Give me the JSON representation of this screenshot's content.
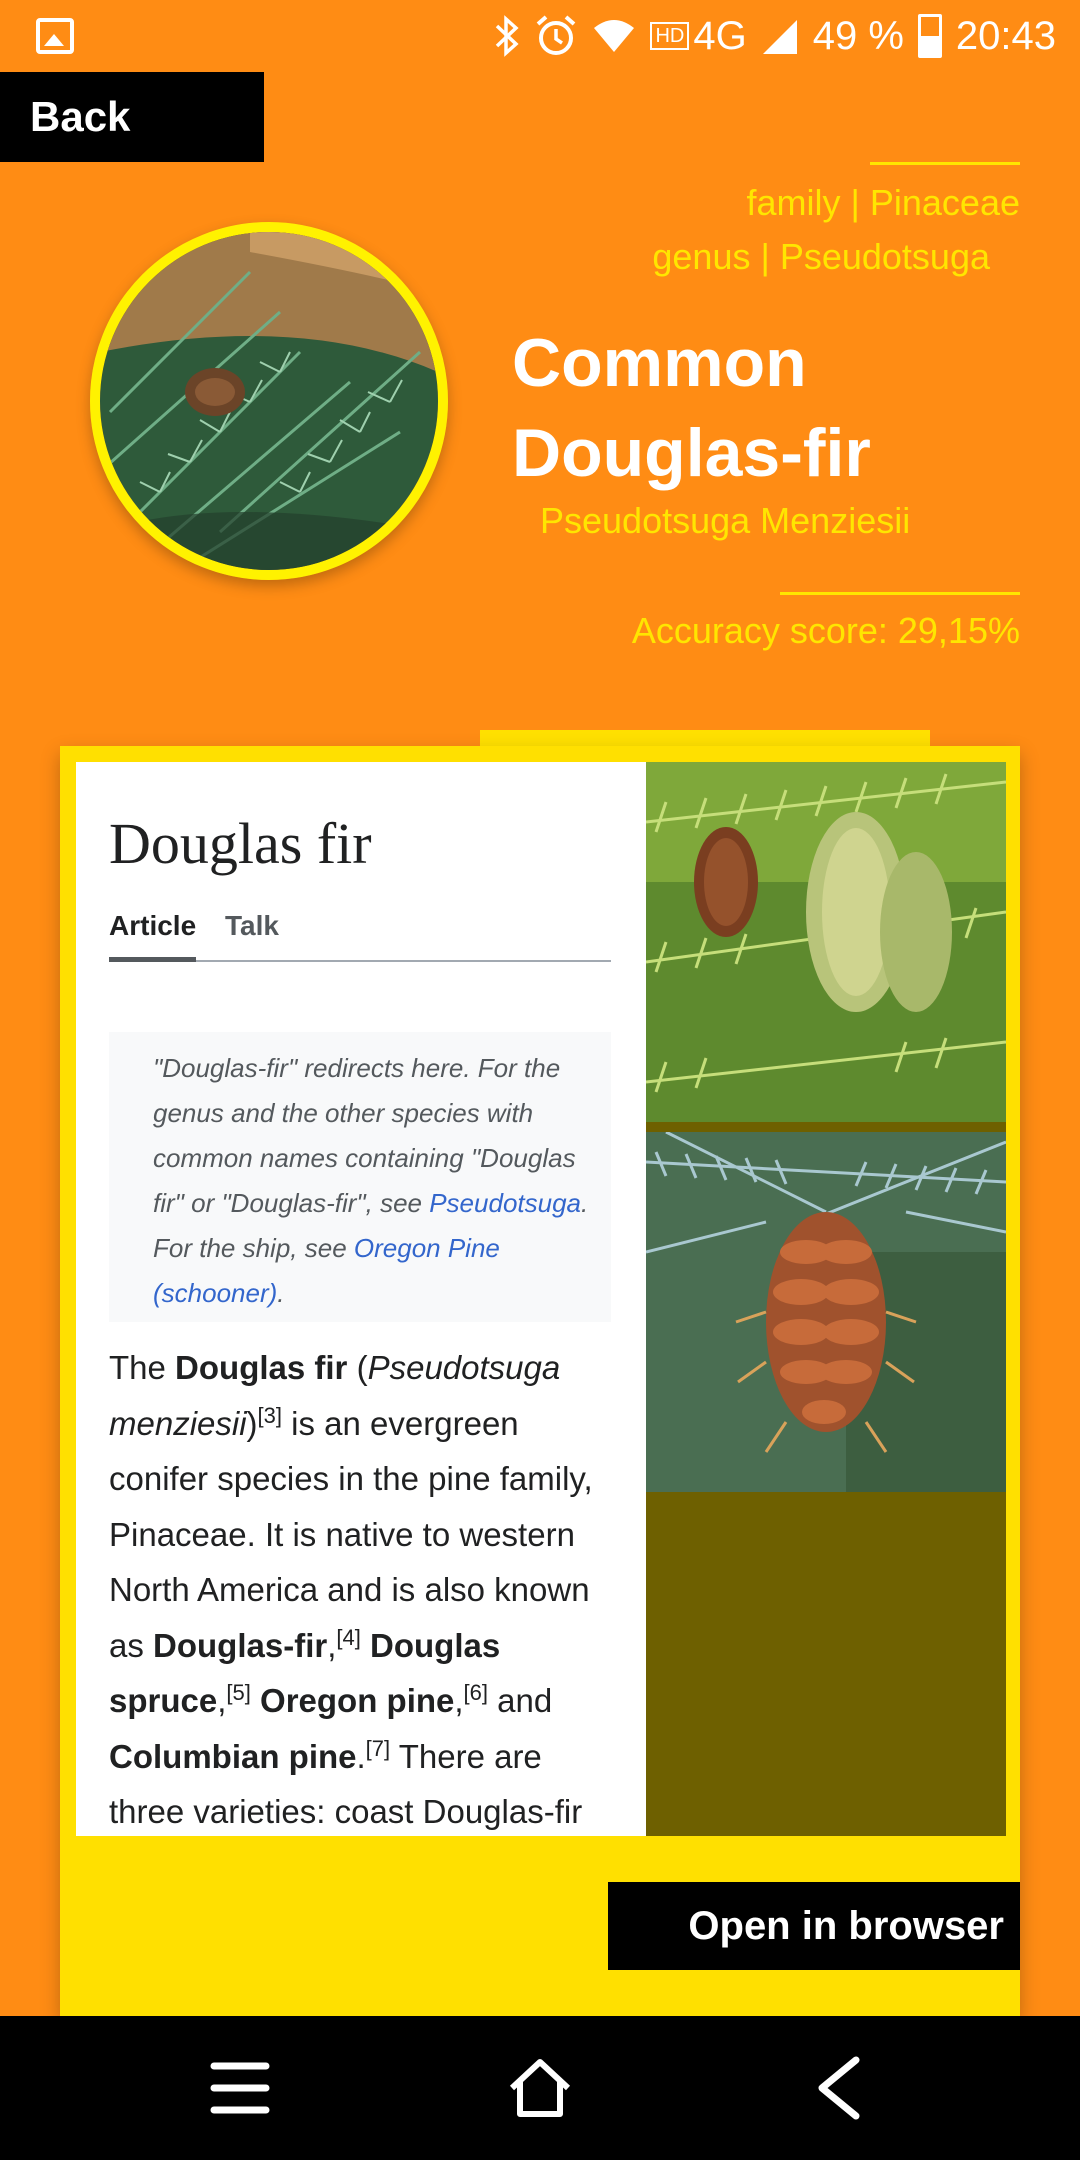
{
  "status_bar": {
    "network": "4G",
    "battery": "49 %",
    "time": "20:43",
    "icons": [
      "gallery-icon",
      "bluetooth-icon",
      "alarm-icon",
      "wifi-icon",
      "hd-icon",
      "signal-icon",
      "battery-icon"
    ]
  },
  "header": {
    "back_label": "Back",
    "family": "family | Pinaceae",
    "genus": "genus | Pseudotsuga",
    "common_name": "Common Douglas-fir",
    "scientific_name": "Pseudotsuga Menziesii",
    "accuracy": "Accuracy score: 29,15%"
  },
  "wiki": {
    "title": "Douglas fir",
    "tabs": [
      "Article",
      "Talk"
    ],
    "hatnote": {
      "text1": "\"Douglas-fir\" redirects here. For the genus and the other species with common names containing \"Douglas fir\" or \"Douglas-fir\", see ",
      "link1": "Pseudotsuga",
      "text2": ". For the ship, see ",
      "link2": "Oregon Pine (schooner)",
      "text3": "."
    },
    "body": {
      "p1": "The ",
      "b1": "Douglas fir",
      "p2": " (",
      "i1": "Pseudotsuga menziesii",
      "p3": ")",
      "s1": "[3]",
      "p4": " is an evergreen conifer species in the pine family, Pinaceae. It is native to western North America and is also known as ",
      "b2": "Douglas-fir",
      "p5": ",",
      "s2": "[4]",
      "p6": " ",
      "b3": "Douglas spruce",
      "p7": ",",
      "s3": "[5]",
      "p8": " ",
      "b4": "Oregon pine",
      "p9": ",",
      "s4": "[6]",
      "p10": " and ",
      "b5": "Columbian pine",
      "p11": ".",
      "s5": "[7]",
      "p12": " There are three varieties: coast Douglas-fir"
    }
  },
  "actions": {
    "open_browser_label": "Open in browser"
  },
  "nav_bar": {
    "icons": [
      "menu-icon",
      "home-icon",
      "back-arrow-icon"
    ]
  },
  "colors": {
    "background": "#FF8C14",
    "accent_yellow": "#FFE600",
    "card_yellow": "#FFE000",
    "photo_placeholder": "#6E6000"
  }
}
